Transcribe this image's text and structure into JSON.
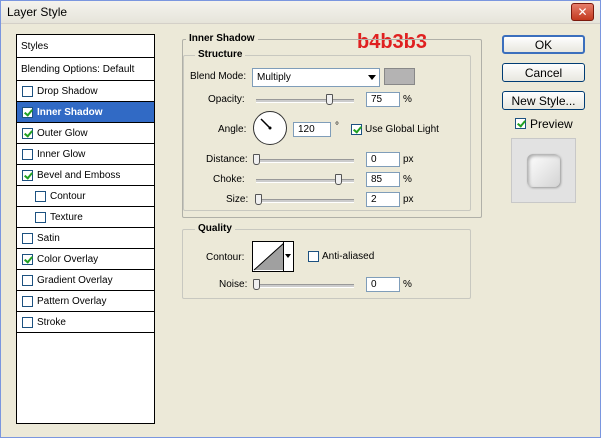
{
  "window": {
    "title": "Layer Style",
    "close_label": "✕"
  },
  "annotation": "b4b3b3",
  "styles_list": {
    "header": "Styles",
    "blending": "Blending Options: Default",
    "items": [
      {
        "label": "Drop Shadow",
        "checked": false,
        "indent": false,
        "selected": false
      },
      {
        "label": "Inner Shadow",
        "checked": true,
        "indent": false,
        "selected": true
      },
      {
        "label": "Outer Glow",
        "checked": true,
        "indent": false,
        "selected": false
      },
      {
        "label": "Inner Glow",
        "checked": false,
        "indent": false,
        "selected": false
      },
      {
        "label": "Bevel and Emboss",
        "checked": true,
        "indent": false,
        "selected": false
      },
      {
        "label": "Contour",
        "checked": false,
        "indent": true,
        "selected": false
      },
      {
        "label": "Texture",
        "checked": false,
        "indent": true,
        "selected": false
      },
      {
        "label": "Satin",
        "checked": false,
        "indent": false,
        "selected": false
      },
      {
        "label": "Color Overlay",
        "checked": true,
        "indent": false,
        "selected": false
      },
      {
        "label": "Gradient Overlay",
        "checked": false,
        "indent": false,
        "selected": false
      },
      {
        "label": "Pattern Overlay",
        "checked": false,
        "indent": false,
        "selected": false
      },
      {
        "label": "Stroke",
        "checked": false,
        "indent": false,
        "selected": false
      }
    ]
  },
  "inner_shadow": {
    "title": "Inner Shadow",
    "structure": {
      "title": "Structure",
      "blend_mode_label": "Blend Mode:",
      "blend_mode_value": "Multiply",
      "shadow_color": "#b4b3b3",
      "opacity_label": "Opacity:",
      "opacity_value": "75",
      "opacity_unit": "%",
      "angle_label": "Angle:",
      "angle_value": "120",
      "angle_unit": "°",
      "use_global_light_label": "Use Global Light",
      "use_global_light_checked": true,
      "distance_label": "Distance:",
      "distance_value": "0",
      "distance_unit": "px",
      "choke_label": "Choke:",
      "choke_value": "85",
      "choke_unit": "%",
      "size_label": "Size:",
      "size_value": "2",
      "size_unit": "px"
    },
    "quality": {
      "title": "Quality",
      "contour_label": "Contour:",
      "anti_aliased_label": "Anti-aliased",
      "anti_aliased_checked": false,
      "noise_label": "Noise:",
      "noise_value": "0",
      "noise_unit": "%"
    }
  },
  "buttons": {
    "ok": "OK",
    "cancel": "Cancel",
    "new_style": "New Style...",
    "preview_label": "Preview",
    "preview_checked": true
  }
}
